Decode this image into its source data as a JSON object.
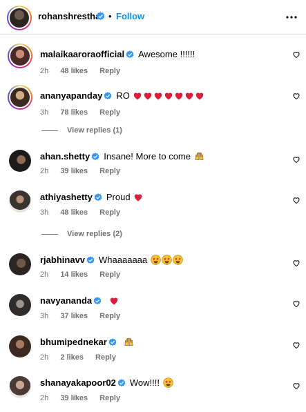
{
  "header": {
    "username": "rohanshrestha",
    "separator": "•",
    "follow_label": "Follow",
    "more_icon": "more-horizontal-icon"
  },
  "colors": {
    "link_blue": "#0095f6",
    "verified_blue": "#3897f0",
    "meta_gray": "#737373",
    "heart_red": "#d91f3c"
  },
  "comments": [
    {
      "username": "malaikaaroraofficial",
      "verified": true,
      "text": "Awesome !!!!!!",
      "time": "2h",
      "likes": "48 likes",
      "reply_label": "Reply"
    },
    {
      "username": "ananyapanday",
      "verified": true,
      "text": "RO",
      "emoji": "7 red hearts",
      "time": "3h",
      "likes": "78 likes",
      "reply_label": "Reply",
      "view_replies": "View replies (1)"
    },
    {
      "username": "ahan.shetty",
      "verified": true,
      "text": "Insane! More to come",
      "emoji": "raising hands",
      "time": "2h",
      "likes": "39 likes",
      "reply_label": "Reply"
    },
    {
      "username": "athiyashetty",
      "verified": true,
      "text": "Proud",
      "emoji": "red heart",
      "time": "3h",
      "likes": "48 likes",
      "reply_label": "Reply",
      "view_replies": "View replies (2)"
    },
    {
      "username": "rjabhinavv",
      "verified": true,
      "text": "Whaaaaaaa",
      "emoji": "3 star-struck faces",
      "time": "2h",
      "likes": "14 likes",
      "reply_label": "Reply"
    },
    {
      "username": "navyananda",
      "verified": true,
      "text": "",
      "emoji": "red heart",
      "time": "3h",
      "likes": "37 likes",
      "reply_label": "Reply"
    },
    {
      "username": "bhumipednekar",
      "verified": true,
      "text": "",
      "emoji": "raising hands",
      "time": "2h",
      "likes": "2 likes",
      "reply_label": "Reply"
    },
    {
      "username": "shanayakapoor02",
      "verified": true,
      "text": "Wow!!!!",
      "emoji": "star-struck face",
      "time": "2h",
      "likes": "39 likes",
      "reply_label": "Reply"
    }
  ]
}
